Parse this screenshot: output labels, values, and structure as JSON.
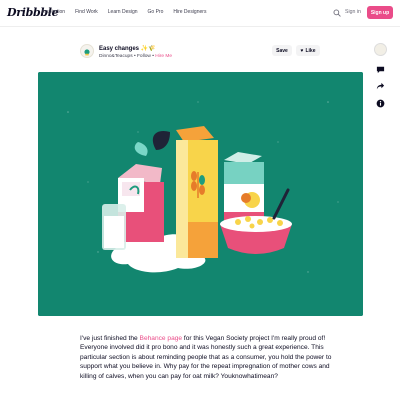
{
  "nav": {
    "logo": "Dribbble",
    "links": [
      "Inspiration",
      "Find Work",
      "Learn Design",
      "Go Pro",
      "Hire Designers"
    ],
    "signin": "Sign in",
    "signup": "Sign up",
    "accent": "#ea4c89"
  },
  "shot": {
    "title": "Easy changes ✨🌾",
    "author": "Dinno&Teacups",
    "follow": "Follow",
    "hire": "Hire Me",
    "save": "Save",
    "like": "Like",
    "background": "#12866f"
  },
  "sidebar": {
    "icons": [
      "avatar",
      "comment-icon",
      "share-icon",
      "info-icon"
    ]
  },
  "description": {
    "part1": "I've just finished the ",
    "link": "Behance page",
    "part2": " for this Vegan Society project I'm really proud of! Everyone involved did it pro bono and it was honestly such a great experience. This particular section is about reminding people that as a consumer, you hold the power to support what you believe in. Why pay for the repeat impregnation of mother cows and killing of calves, when you can pay for oat milk? Youknowhatimean?"
  }
}
